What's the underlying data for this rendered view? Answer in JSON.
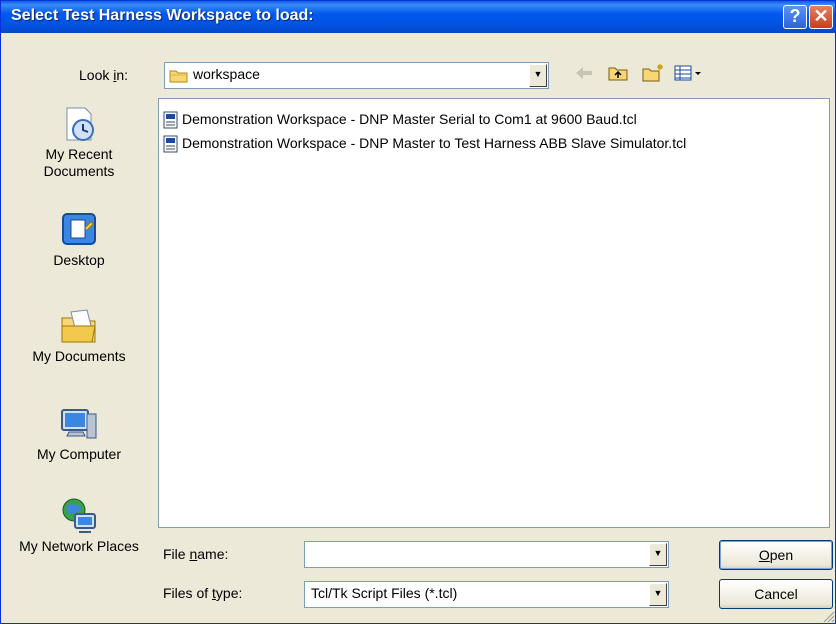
{
  "window": {
    "title": "Select Test Harness Workspace to load:",
    "help_label": "?",
    "close_label": "✕"
  },
  "lookin": {
    "label_pre": "Look ",
    "label_u": "i",
    "label_post": "n:",
    "value": "workspace"
  },
  "places": [
    {
      "label": "My Recent Documents",
      "icon": "recent-documents-icon"
    },
    {
      "label": "Desktop",
      "icon": "desktop-icon"
    },
    {
      "label": "My Documents",
      "icon": "my-documents-icon"
    },
    {
      "label": "My Computer",
      "icon": "my-computer-icon"
    },
    {
      "label": "My Network Places",
      "icon": "network-places-icon"
    }
  ],
  "files": [
    {
      "name": "Demonstration Workspace - DNP Master Serial to Com1 at 9600 Baud.tcl"
    },
    {
      "name": "Demonstration Workspace - DNP Master to Test Harness ABB Slave Simulator.tcl"
    }
  ],
  "filename": {
    "label_pre": "File ",
    "label_u": "n",
    "label_post": "ame:",
    "value": ""
  },
  "filetype": {
    "label_pre": "Files of ",
    "label_u": "t",
    "label_post": "ype:",
    "value": "Tcl/Tk Script Files (*.tcl)"
  },
  "buttons": {
    "open_u": "O",
    "open_rest": "pen",
    "cancel": "Cancel"
  },
  "colors": {
    "titlebar": "#0054e3",
    "face": "#ece9d8",
    "border": "#7f9db9"
  }
}
